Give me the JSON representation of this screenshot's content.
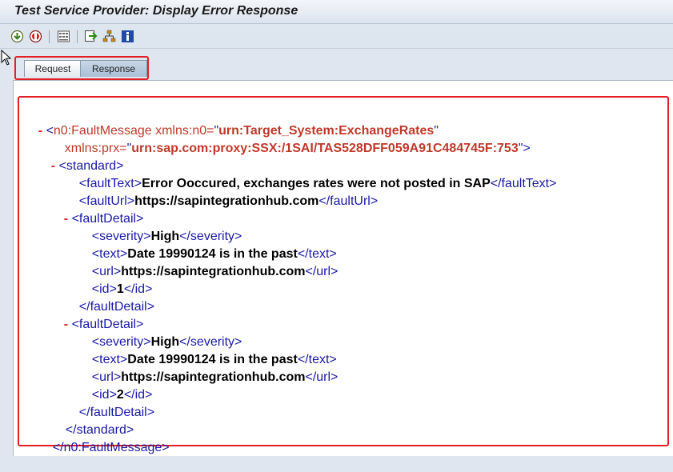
{
  "window": {
    "title": "Test Service Provider: Display Error Response"
  },
  "toolbar": {
    "icons": [
      "execute-icon",
      "stop-icon",
      "layout-icon",
      "export-icon",
      "hierarchy-icon",
      "info-icon"
    ]
  },
  "tabs": [
    {
      "label": "Request"
    },
    {
      "label": "Response"
    }
  ],
  "xml": {
    "minus": "-",
    "root_open_lt": "<",
    "root_name": "n0:FaultMessage",
    "attr1_name": " xmlns:n0=",
    "attr1_value": "urn:Target_System:ExchangeRates",
    "attr2_name": "xmlns:prx=",
    "attr2_value": "urn:sap.com:proxy:SSX:/1SAI/TAS528DFF059A91C484745F:753",
    "root_open_gt": ">",
    "standard_open": "<standard>",
    "faultText_open": "<faultText>",
    "faultText_value": "Error Ooccured, exchanges rates were not posted in SAP",
    "faultText_close": "</faultText>",
    "faultUrl_open": "<faultUrl>",
    "faultUrl_value": "https://sapintegrationhub.com",
    "faultUrl_close": "</faultUrl>",
    "faultDetail_open": "<faultDetail>",
    "faultDetail_close": "</faultDetail>",
    "details": [
      {
        "severity": "High",
        "text": "Date 19990124 is in the past",
        "url": "https://sapintegrationhub.com",
        "id": "1"
      },
      {
        "severity": "High",
        "text": "Date 19990124 is in the past",
        "url": "https://sapintegrationhub.com",
        "id": "2"
      }
    ],
    "severity_open": "<severity>",
    "severity_close": "</severity>",
    "text_open": "<text>",
    "text_close": "</text>",
    "url_open": "<url>",
    "url_close": "</url>",
    "id_open": "<id>",
    "id_close": "</id>",
    "standard_close": "</standard>",
    "root_close": "</n0:FaultMessage>"
  }
}
